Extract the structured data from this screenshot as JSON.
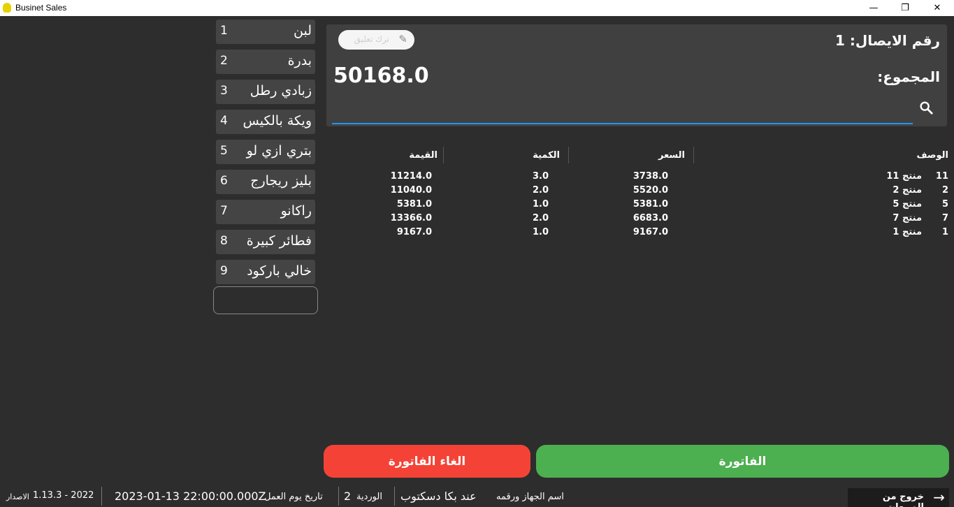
{
  "window": {
    "title": "Businet Sales",
    "controls": {
      "minimize": "—",
      "maximize": "❐",
      "close": "✕"
    }
  },
  "quick_products": [
    {
      "name": "لبن",
      "number": "1"
    },
    {
      "name": "بدرة",
      "number": "2"
    },
    {
      "name": "زبادي رطل",
      "number": "3"
    },
    {
      "name": "ويكة بالكيس",
      "number": "4"
    },
    {
      "name": "بتري ازي لو",
      "number": "5"
    },
    {
      "name": "بليز ريجارج",
      "number": "6"
    },
    {
      "name": "راكانو",
      "number": "7"
    },
    {
      "name": "فطائر كبيرة",
      "number": "8"
    },
    {
      "name": "خالي باركود",
      "number": "9"
    }
  ],
  "invoice": {
    "receipt_label": "رقم الايصال: 1",
    "total_label": "المجموع:",
    "total_value": "50168.0",
    "comment_button": "ترك تعليق",
    "search_placeholder": ""
  },
  "table": {
    "headers": {
      "description": "الوصف",
      "price": "السعر",
      "quantity": "الكمية",
      "value": "القيمة"
    },
    "rows": [
      {
        "index": "11",
        "name": "منتج 11",
        "price": "3738.0",
        "qty": "3.0",
        "value": "11214.0"
      },
      {
        "index": "2",
        "name": "منتج 2",
        "price": "5520.0",
        "qty": "2.0",
        "value": "11040.0"
      },
      {
        "index": "5",
        "name": "منتج 5",
        "price": "5381.0",
        "qty": "1.0",
        "value": "5381.0"
      },
      {
        "index": "7",
        "name": "منتج 7",
        "price": "6683.0",
        "qty": "2.0",
        "value": "13366.0"
      },
      {
        "index": "1",
        "name": "منتج 1",
        "price": "9167.0",
        "qty": "1.0",
        "value": "9167.0"
      }
    ]
  },
  "actions": {
    "cancel_invoice": "الغاء الفاتورة",
    "invoice": "الفاتورة"
  },
  "status_bar": {
    "version_label": "الاصدار",
    "version_value": "1.13.3 - 2022",
    "workday_label": "تاريخ يوم العمل",
    "workday_value": "2023-01-13 22:00:00.000Z",
    "shift_label": "الوردية",
    "shift_value": "2",
    "device_label": "اسم الجهاز ورقمه",
    "device_value": "عند بكا دسكتوب",
    "exit_button": "خروج من المبيعات"
  },
  "colors": {
    "background": "#2d2d2d",
    "panel": "#404040",
    "accent_blue": "#2196f3",
    "cancel_red": "#f44336",
    "invoice_green": "#4caf50"
  }
}
